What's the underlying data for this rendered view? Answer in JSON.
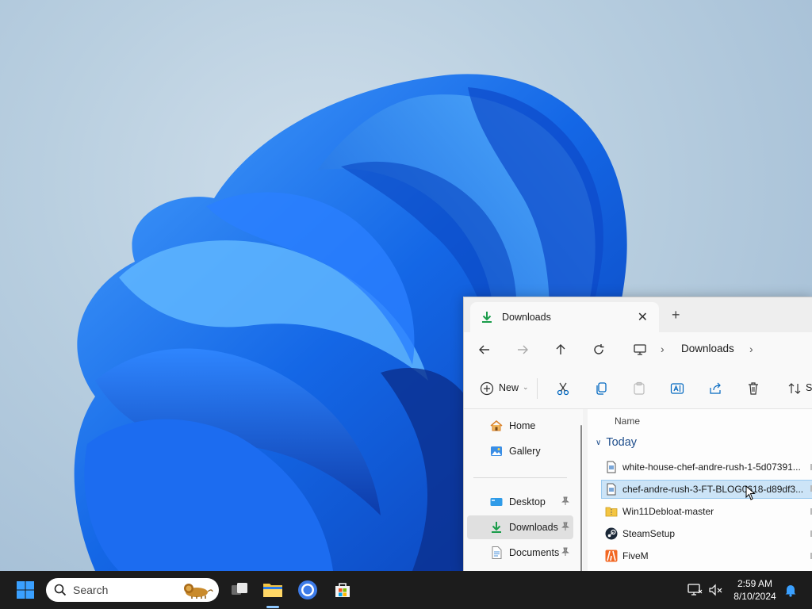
{
  "explorer": {
    "tab": {
      "title": "Downloads",
      "icon": "download-icon"
    },
    "address": {
      "crumbs": [
        "Downloads"
      ]
    },
    "commands": {
      "new_label": "New",
      "sort_label": "Se"
    },
    "nav": {
      "items": [
        {
          "label": "Home",
          "icon": "home-icon"
        },
        {
          "label": "Gallery",
          "icon": "gallery-icon"
        },
        {
          "label": "Desktop",
          "icon": "desktop-folder-icon",
          "pinned": true
        },
        {
          "label": "Downloads",
          "icon": "download-icon",
          "pinned": true,
          "selected": true
        },
        {
          "label": "Documents",
          "icon": "documents-icon",
          "pinned": true
        }
      ]
    },
    "content": {
      "column_name": "Name",
      "group": "Today",
      "files": [
        {
          "name": "white-house-chef-andre-rush-1-5d07391...",
          "icon": "document-file-icon"
        },
        {
          "name": "chef-andre-rush-3-FT-BLOG0618-d89df3...",
          "icon": "document-file-icon",
          "selected": true
        },
        {
          "name": "Win11Debloat-master",
          "icon": "zip-folder-icon"
        },
        {
          "name": "SteamSetup",
          "icon": "steam-icon"
        },
        {
          "name": "FiveM",
          "icon": "fivem-icon"
        }
      ]
    }
  },
  "taskbar": {
    "search_placeholder": "Search",
    "time": "2:59 AM",
    "date": "8/10/2024"
  },
  "colors": {
    "accent": "#0067c0",
    "taskbar": "#1c1c1c",
    "selection": "#cce4f7"
  }
}
